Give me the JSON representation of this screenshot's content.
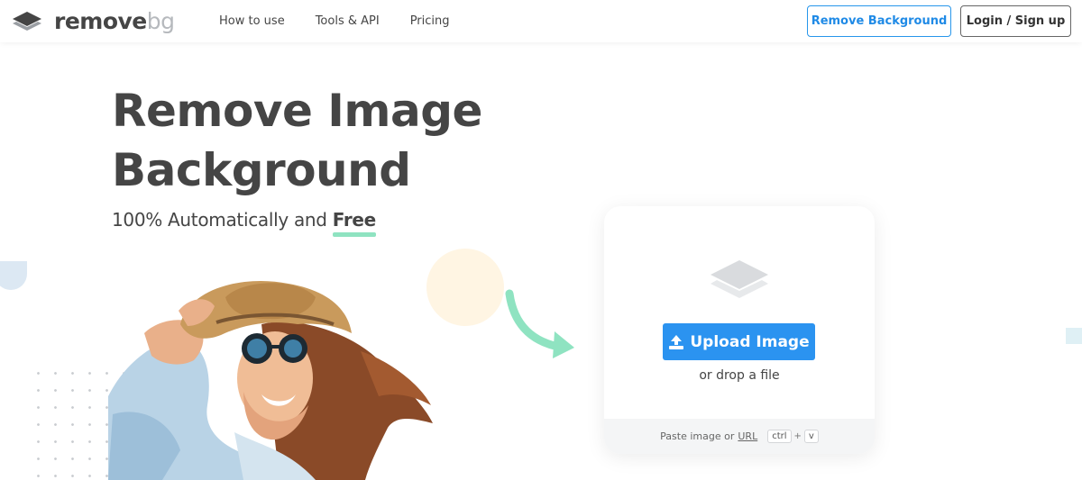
{
  "header": {
    "logo": {
      "word_main": "remove",
      "word_accent": "bg",
      "icon": "layers-logo-icon"
    },
    "nav": [
      {
        "label": "How to use"
      },
      {
        "label": "Tools & API"
      },
      {
        "label": "Pricing"
      }
    ],
    "remove_background_label": "Remove Background",
    "login_label": "Login / Sign up"
  },
  "hero": {
    "title_line1": "Remove Image",
    "title_line2": "Background",
    "subtitle_prefix": "100% Automatically and",
    "subtitle_highlight": "Free"
  },
  "upload_card": {
    "icon": "layers-icon",
    "upload_button_label": "Upload Image",
    "upload_icon": "upload-icon",
    "drop_text": "or drop a file",
    "paste_text": "Paste image or",
    "url_label": "URL",
    "key_ctrl": "ctrl",
    "key_plus": "+",
    "key_v": "v"
  },
  "colors": {
    "accent_blue": "#2b93f0",
    "text_dark": "#454545",
    "underline_green": "#8fe3c1",
    "arrow_green": "#8fe3c1"
  }
}
